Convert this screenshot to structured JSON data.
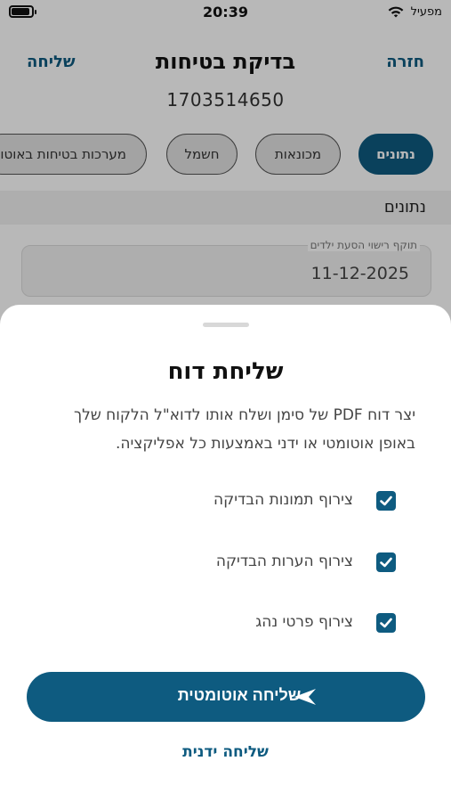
{
  "status_bar": {
    "time": "20:39",
    "carrier": "מפעיל"
  },
  "header": {
    "title": "בדיקת בטיחות",
    "back_label": "חזרה",
    "send_label": "שליחה",
    "subtitle": "1703514650"
  },
  "tabs": [
    {
      "label": "נתונים",
      "active": true
    },
    {
      "label": "מכונאות",
      "active": false
    },
    {
      "label": "חשמל",
      "active": false
    },
    {
      "label": "מערכות בטיחות באוטובוס",
      "active": false
    }
  ],
  "section": {
    "title": "נתונים"
  },
  "field": {
    "label": "תוקף רישוי הסעת ילדים",
    "value": "11-12-2025"
  },
  "sheet": {
    "title": "שליחת דוח",
    "description_line1": "יצר דוח PDF של סימן ושלח אותו לדוא\"ל הלקוח שלך",
    "description_line2": "באופן אוטומטי או ידני באמצעות כל אפליקציה.",
    "options": [
      {
        "label": "צירוף תמונות הבדיקה",
        "checked": true
      },
      {
        "label": "צירוף הערות הבדיקה",
        "checked": true
      },
      {
        "label": "צירוף פרטי נהג",
        "checked": true
      }
    ],
    "primary_button": "שליחה אוטומטית",
    "secondary_button": "שליחה ידנית"
  },
  "colors": {
    "accent": "#0e5b80",
    "tab_bg": "#e2e2e2",
    "overlay": "rgba(0,0,0,0.28)"
  },
  "icons": {
    "send": "send-arrow-icon",
    "checkbox": "checkmark-icon",
    "wifi": "wifi-icon",
    "battery": "battery-icon"
  }
}
